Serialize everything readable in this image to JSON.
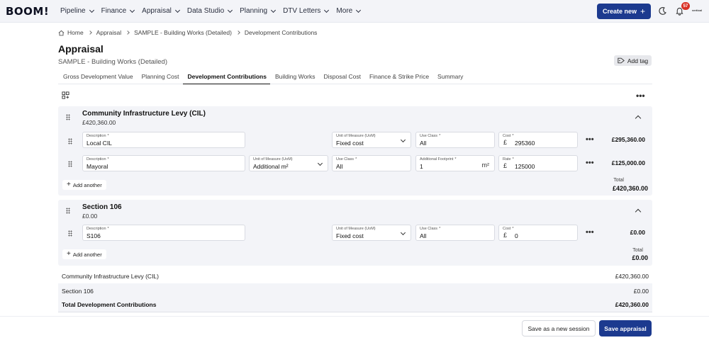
{
  "nav": {
    "logo": "BOOM!",
    "items": [
      {
        "label": "Pipeline"
      },
      {
        "label": "Finance"
      },
      {
        "label": "Appraisal"
      },
      {
        "label": "Data Studio"
      },
      {
        "label": "Planning"
      },
      {
        "label": "DTV Letters"
      },
      {
        "label": "More"
      }
    ],
    "create_label": "Create new",
    "notification_count": "57",
    "avatar_label": "vertical"
  },
  "breadcrumb": [
    "Home",
    "Appraisal",
    "SAMPLE - Building Works (Detailed)",
    "Development Contributions"
  ],
  "page": {
    "title": "Appraisal",
    "subtitle": "SAMPLE - Building Works (Detailed)",
    "add_tag": "Add tag"
  },
  "tabs": [
    {
      "label": "Gross Development Value"
    },
    {
      "label": "Planning Cost"
    },
    {
      "label": "Development Contributions"
    },
    {
      "label": "Building Works"
    },
    {
      "label": "Disposal Cost"
    },
    {
      "label": "Finance & Strike Price"
    },
    {
      "label": "Summary"
    }
  ],
  "cil": {
    "title": "Community Infrastructure Levy (CIL)",
    "amount": "£420,360.00",
    "rows": [
      {
        "description_label": "Description",
        "description": "Local CIL",
        "uom_label": "Unit of Measure (UoM)",
        "uom": "Fixed cost",
        "use_class_label": "Use Class",
        "use_class": "All",
        "cost_label": "Cost",
        "currency": "£",
        "cost": "295360",
        "total": "£295,360.00"
      },
      {
        "description_label": "Description",
        "description": "Mayoral",
        "uom_label": "Unit of Measure (UoM)",
        "uom": "Additional m²",
        "use_class_label": "Use Class",
        "use_class": "All",
        "footprint_label": "Additional Footprint",
        "footprint": "1",
        "footprint_unit": "m²",
        "rate_label": "Rate",
        "currency": "£",
        "rate": "125000",
        "total": "£125,000.00"
      }
    ],
    "add_another": "Add another",
    "total_label": "Total",
    "total": "£420,360.00"
  },
  "s106": {
    "title": "Section 106",
    "amount": "£0.00",
    "rows": [
      {
        "description_label": "Description",
        "description": "S106",
        "uom_label": "Unit of Measure (UoM)",
        "uom": "Fixed cost",
        "use_class_label": "Use Class",
        "use_class": "All",
        "cost_label": "Cost",
        "currency": "£",
        "cost": "0",
        "total": "£0.00"
      }
    ],
    "add_another": "Add another",
    "total_label": "Total",
    "total": "£0.00"
  },
  "summary": [
    {
      "label": "Community Infrastructure Levy (CIL)",
      "value": "£420,360.00"
    },
    {
      "label": "Section 106",
      "value": "£0.00"
    },
    {
      "label": "Total Development Contributions",
      "value": "£420,360.00"
    }
  ],
  "actions": {
    "save_session": "Save as a new session",
    "save_appraisal": "Save appraisal"
  },
  "colors": {
    "primary": "#1c3a8f",
    "badge": "#d93025",
    "section_bg": "#f3f4f8"
  }
}
